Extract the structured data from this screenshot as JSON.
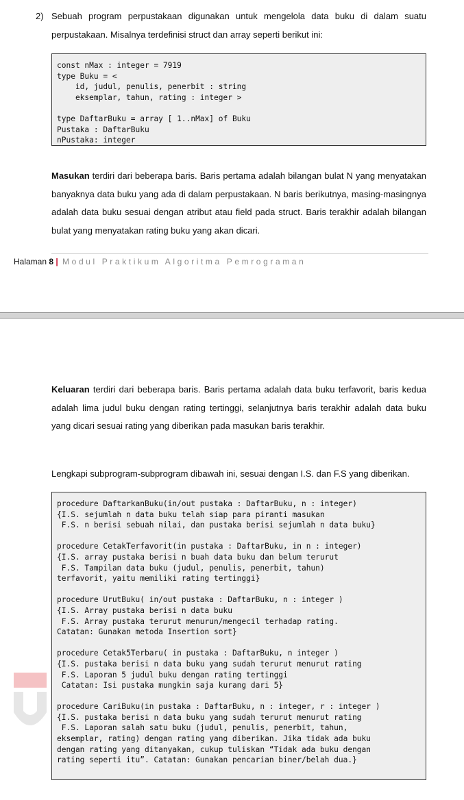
{
  "page1": {
    "question_number": "2)",
    "intro": "Sebuah program perpustakaan digunakan untuk mengelola data buku di dalam suatu perpustakaan. Misalnya terdefinisi struct dan array seperti berikut ini:",
    "code_lines": [
      "const nMax : integer = 7919",
      "type Buku = <",
      "    id, judul, penulis, penerbit : string",
      "    eksemplar, tahun, rating : integer >",
      "",
      "type DaftarBuku = array [ 1..nMax] of Buku",
      "Pustaka : DaftarBuku",
      "nPustaka: integer"
    ],
    "masukan_label": "Masukan",
    "masukan_text": " terdiri dari beberapa baris. Baris pertama adalah bilangan bulat N yang menyatakan banyaknya data buku yang ada di dalam perpustakaan. N baris berikutnya, masing-masingnya adalah data buku sesuai dengan atribut atau field pada struct. Baris terakhir adalah bilangan bulat yang menyatakan rating buku yang akan dicari.",
    "footer_prefix": "Halaman ",
    "footer_page": "8",
    "footer_separator": " | ",
    "footer_module": "Modul Praktikum Algoritma Pemrograman"
  },
  "page2": {
    "keluaran_label": "Keluaran",
    "keluaran_text": " terdiri dari beberapa baris. Baris pertama adalah data buku terfavorit, baris kedua adalah lima judul buku dengan rating tertinggi, selanjutnya baris terakhir adalah data buku yang dicari sesuai rating yang diberikan pada masukan baris terakhir.",
    "instruction": "Lengkapi subprogram-subprogram dibawah ini, sesuai dengan I.S. dan F.S yang diberikan.",
    "code_blocks": [
      [
        "procedure DaftarkanBuku(in/out pustaka : DaftarBuku, n : integer)",
        "{I.S. sejumlah n data buku telah siap para piranti masukan",
        " F.S. n berisi sebuah nilai, dan pustaka berisi sejumlah n data buku}"
      ],
      [
        "procedure CetakTerfavorit(in pustaka : DaftarBuku, in n : integer)",
        "{I.S. array pustaka berisi n buah data buku dan belum terurut",
        " F.S. Tampilan data buku (judul, penulis, penerbit, tahun)",
        "terfavorit, yaitu memiliki rating tertinggi}"
      ],
      [
        "procedure UrutBuku( in/out pustaka : DaftarBuku, n : integer )",
        "{I.S. Array pustaka berisi n data buku",
        " F.S. Array pustaka terurut menurun/mengecil terhadap rating.",
        "Catatan: Gunakan metoda Insertion sort}"
      ],
      [
        "procedure Cetak5Terbaru( in pustaka : DaftarBuku, n integer )",
        "{I.S. pustaka berisi n data buku yang sudah terurut menurut rating",
        " F.S. Laporan 5 judul buku dengan rating tertinggi",
        " Catatan: Isi pustaka mungkin saja kurang dari 5}"
      ],
      [
        "procedure CariBuku(in pustaka : DaftarBuku, n : integer, r : integer )",
        "{I.S. pustaka berisi n data buku yang sudah terurut menurut rating",
        " F.S. Laporan salah satu buku (judul, penulis, penerbit, tahun,",
        "eksemplar, rating) dengan rating yang diberikan. Jika tidak ada buku",
        "dengan rating yang ditanyakan, cukup tuliskan “Tidak ada buku dengan",
        "rating seperti itu”. Catatan: Gunakan pencarian biner/belah dua.}"
      ]
    ]
  },
  "colors": {
    "accent_red": "#c8102e",
    "watermark_pink": "#f5c2c4",
    "watermark_grey": "#e3e3e3",
    "code_bg": "#eeeeee"
  }
}
